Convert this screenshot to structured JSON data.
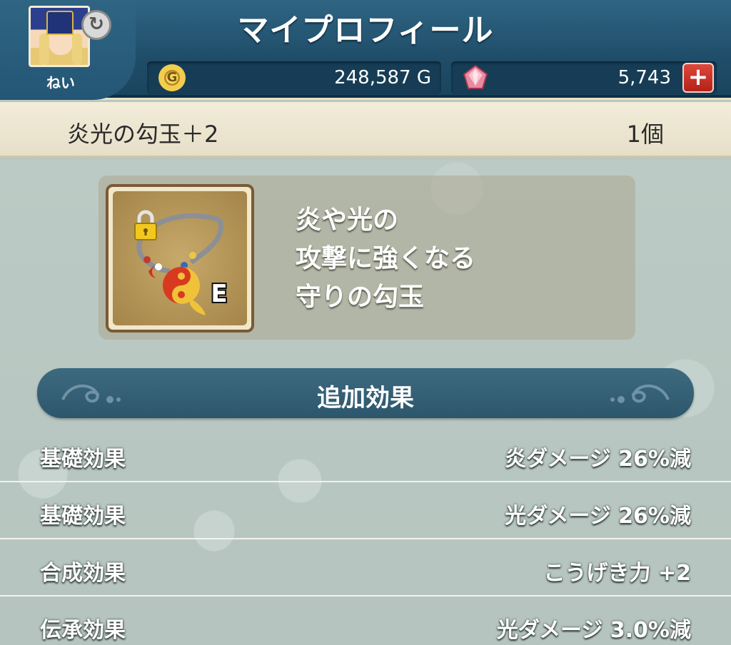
{
  "header": {
    "title": "マイプロフィール",
    "player_name": "ねい",
    "gold_value": "248,587 G",
    "gold_icon_label": "G",
    "gem_value": "5,743",
    "plus_label": "+"
  },
  "item": {
    "name": "炎光の勾玉＋2",
    "count": "1個",
    "equipped_badge": "E",
    "description": [
      "炎や光の",
      "攻撃に強くなる",
      "守りの勾玉"
    ]
  },
  "section": {
    "title": "追加効果"
  },
  "effects": [
    {
      "label": "基礎効果",
      "value": "炎ダメージ 26%減"
    },
    {
      "label": "基礎効果",
      "value": "光ダメージ 26%減"
    },
    {
      "label": "合成効果",
      "value": "こうげき力 +2"
    },
    {
      "label": "伝承効果",
      "value": "光ダメージ 3.0%減"
    }
  ],
  "icons": {
    "avatar": "avatar-icon",
    "swap": "swap-icon",
    "gold": "gold-coin-icon",
    "gem": "gem-icon",
    "item": "magatama-necklace-icon",
    "lock": "lock-icon"
  },
  "colors": {
    "header_bg": "#1f4d69",
    "item_bar_bg": "#f2ecd9",
    "section_bg": "#3e6a80",
    "plus_button": "#c52b20"
  }
}
